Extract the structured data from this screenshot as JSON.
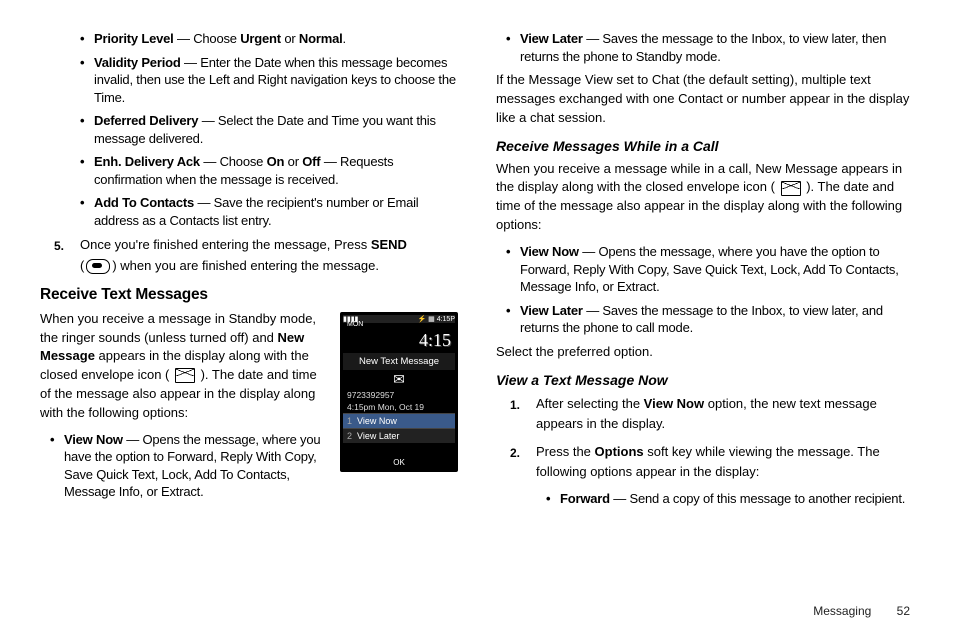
{
  "col1": {
    "bullets": [
      {
        "label": "Priority Level",
        "dash": " — Choose ",
        "b1": "Urgent",
        "mid": " or ",
        "b2": "Normal",
        "end": "."
      },
      {
        "label": "Validity Period",
        "text": " — Enter the Date when this message becomes invalid, then use the Left and Right navigation keys to choose the Time."
      },
      {
        "label": "Deferred Delivery",
        "text": " — Select the Date and Time you want this message delivered."
      },
      {
        "label": "Enh. Delivery Ack",
        "dash": " — Choose ",
        "b1": "On",
        "mid": " or ",
        "b2": "Off",
        "end": " — Requests confirmation when the message is received."
      },
      {
        "label": "Add To Contacts",
        "text": " — Save the recipient's number or Email address as a Contacts list entry."
      }
    ],
    "step5_num": "5.",
    "step5_a": "Once you're finished entering the message, Press ",
    "step5_b": "SEND",
    "step5_c": " (",
    "step5_d": ") when you are finished entering the message.",
    "h_receive": "Receive Text Messages",
    "p_receive_a": "When you receive a message in Standby mode, the ringer sounds (unless turned off) and ",
    "p_receive_b": "New Message",
    "p_receive_c": " appears in the display along with the closed envelope icon ( ",
    "p_receive_d": " ). The date and time of the message also appear in the display along with the following options:",
    "vn_label": "View Now",
    "vn_text": " — Opens the message, where you have the option to Forward, Reply With Copy, Save Quick Text, Lock, Add To Contacts, Message Info, or Extract."
  },
  "phone": {
    "status_l": "▮▮▮▮",
    "status_r": "⚡ ▦ 4:15P",
    "day": "MON",
    "clock": "4:15",
    "banner": "New Text Message",
    "number": "9723392957",
    "time": "4:15pm Mon, Oct 19",
    "opt1_n": "1",
    "opt1": "View Now",
    "opt2_n": "2",
    "opt2": "View Later",
    "ok": "OK"
  },
  "col2": {
    "vl_label": "View Later",
    "vl_text": " — Saves the message to the Inbox, to view later, then returns the phone to Standby mode.",
    "p_chat": "If the Message View set to Chat (the default setting), multiple text messages exchanged with one Contact or number appear in the display like a chat session.",
    "h_call": "Receive Messages While in a Call",
    "p_call_a": "When you receive a message while in a call, New Message appears in the display along with the closed envelope icon ( ",
    "p_call_b": " ). The date and time of the message also appear in the display along with the following options:",
    "vn2_label": "View Now",
    "vn2_text": " — Opens the message, where you have the option to Forward, Reply With Copy, Save Quick Text, Lock, Add To Contacts, Message Info, or Extract.",
    "vl2_label": "View Later",
    "vl2_text": " — Saves the message to the Inbox, to view later, and returns the phone to call mode.",
    "p_select": "Select the preferred option.",
    "h_view": "View a Text Message Now",
    "s1_num": "1.",
    "s1_a": "After selecting the ",
    "s1_b": "View Now",
    "s1_c": " option, the new text message appears in the display.",
    "s2_num": "2.",
    "s2_a": "Press the ",
    "s2_b": "Options",
    "s2_c": " soft key while viewing the message. The following options appear in the display:",
    "fwd_label": "Forward",
    "fwd_text": " — Send a copy of this message to another recipient."
  },
  "footer": {
    "section": "Messaging",
    "page": "52"
  }
}
